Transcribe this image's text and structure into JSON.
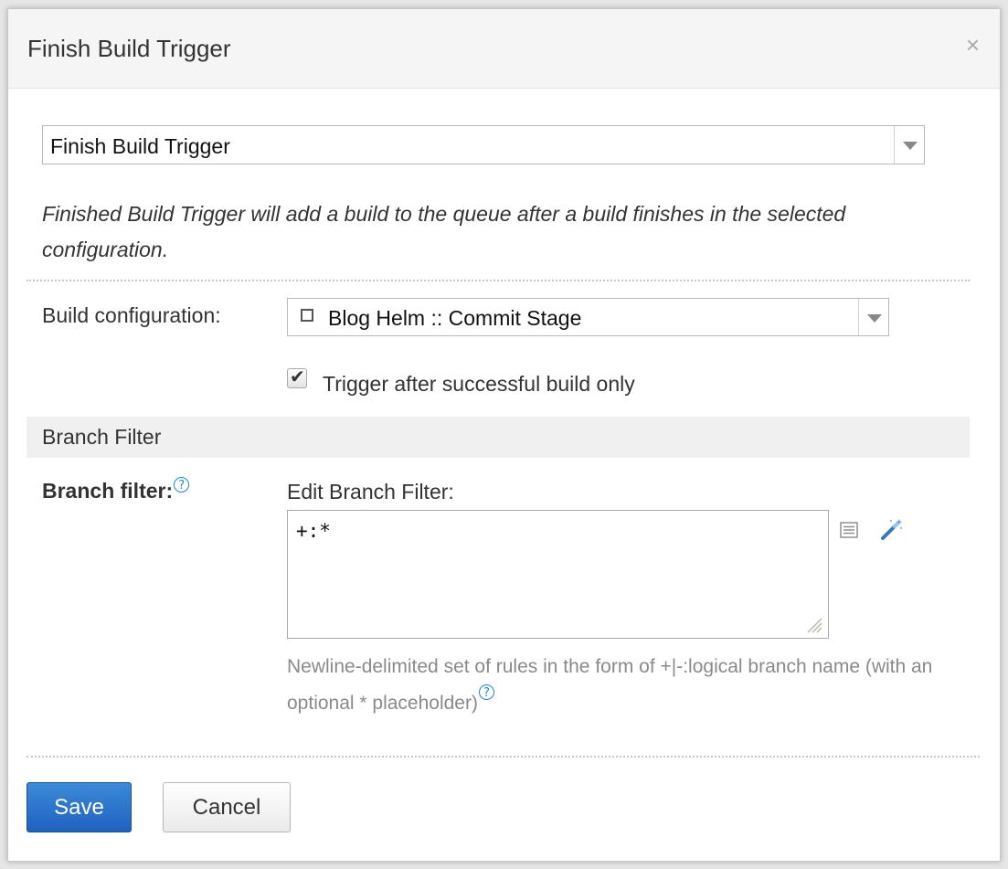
{
  "dialog": {
    "title": "Finish Build Trigger",
    "close_symbol": "×"
  },
  "trigger_type": {
    "selected": "Finish Build Trigger",
    "dropdown_icon": "triangle-down-icon"
  },
  "description": "Finished Build Trigger will add a build to the queue after a build finishes in the selected configuration.",
  "build_configuration": {
    "label": "Build configuration:",
    "selected": "Blog Helm :: Commit Stage",
    "item_icon": "square-icon",
    "dropdown_icon": "triangle-down-icon"
  },
  "successful_only": {
    "label": "Trigger after successful build only",
    "checked": true,
    "check_symbol": "✔"
  },
  "branch_section": {
    "title": "Branch Filter"
  },
  "branch_filter": {
    "label": "Branch filter:",
    "help_symbol": "?",
    "edit_label": "Edit Branch Filter:",
    "value": "+:*",
    "hint": "Newline-delimited set of rules in the form of +|-:logical branch name (with an optional * placeholder)",
    "side_icons": [
      "list-icon",
      "magic-wand-icon"
    ]
  },
  "buttons": {
    "save": "Save",
    "cancel": "Cancel"
  },
  "colors": {
    "primary": "#2a72cc",
    "help": "#1a8ad4",
    "hint_text": "#8a8a8a"
  }
}
